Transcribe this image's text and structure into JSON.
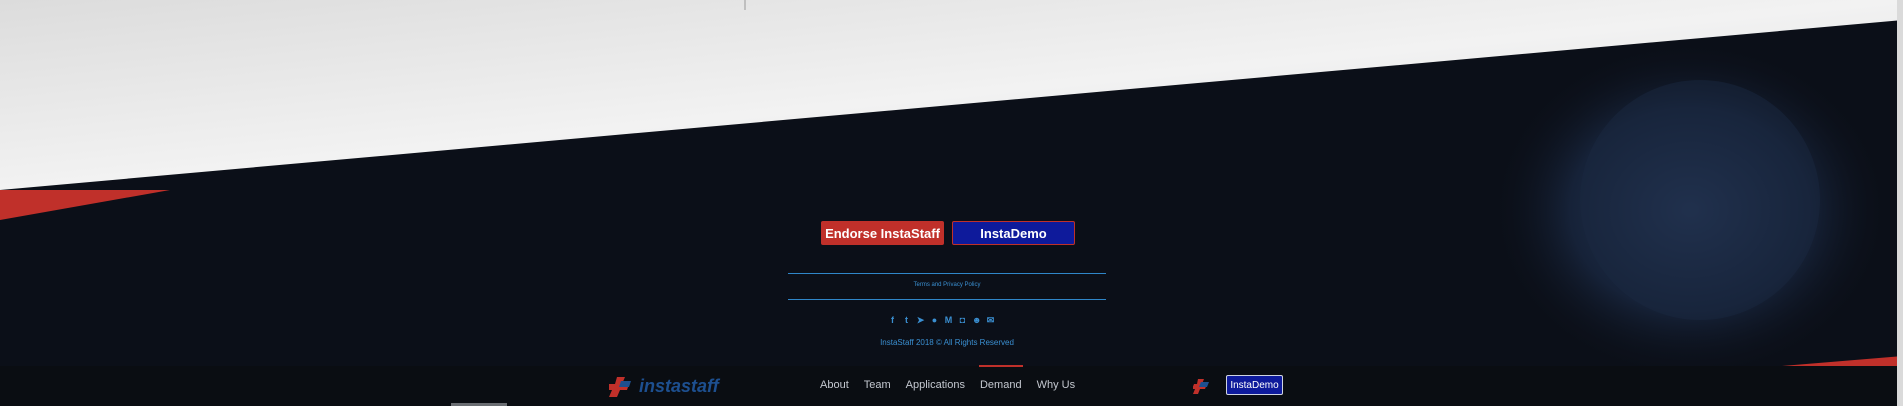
{
  "cta": {
    "endorse_label": "Endorse InstaStaff",
    "demo_label": "InstaDemo"
  },
  "footer": {
    "terms_link": "Terms and Privacy Policy",
    "copyright": "InstaStaff 2018 © All Rights Reserved",
    "socials": [
      {
        "icon": "facebook-icon",
        "glyph": "f"
      },
      {
        "icon": "twitter-icon",
        "glyph": "t"
      },
      {
        "icon": "telegram-icon",
        "glyph": "➤"
      },
      {
        "icon": "github-icon",
        "glyph": "●"
      },
      {
        "icon": "medium-icon",
        "glyph": "M"
      },
      {
        "icon": "discord-icon",
        "glyph": "◘"
      },
      {
        "icon": "reddit-icon",
        "glyph": "☻"
      },
      {
        "icon": "email-icon",
        "glyph": "✉"
      }
    ]
  },
  "navbar": {
    "logo_text": "instastaff",
    "items": [
      {
        "label": "About"
      },
      {
        "label": "Team"
      },
      {
        "label": "Applications"
      },
      {
        "label": "Demand"
      },
      {
        "label": "Why Us"
      }
    ],
    "active_item": "Demand",
    "demo_button": "InstaDemo"
  },
  "colors": {
    "accent_red": "#c0302a",
    "accent_blue": "#0e1a9b",
    "link_blue": "#3a8fd1",
    "dark_bg": "#0b0f18"
  }
}
